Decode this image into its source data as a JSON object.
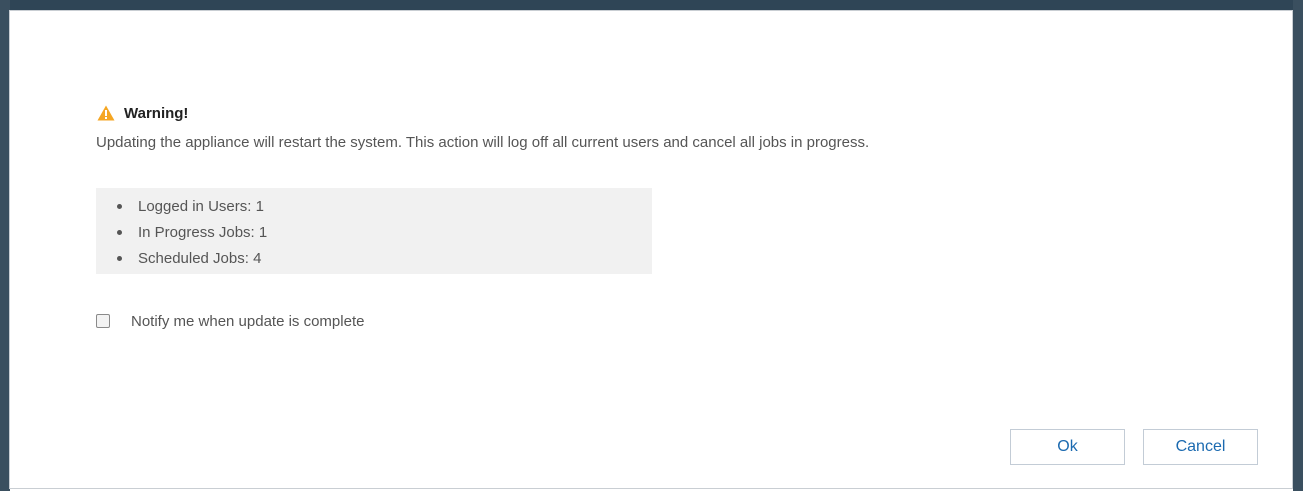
{
  "warning": {
    "icon": "warning-triangle-icon",
    "icon_color": "#f5a623",
    "title": "Warning!",
    "message": "Updating the appliance will restart the system. This action will log off all current users and cancel all jobs in progress."
  },
  "stats": [
    {
      "label": "Logged in Users: 1"
    },
    {
      "label": "In Progress Jobs: 1"
    },
    {
      "label": "Scheduled Jobs: 4"
    }
  ],
  "notify": {
    "checked": false,
    "label": "Notify me when update is complete"
  },
  "buttons": {
    "ok_label": "Ok",
    "cancel_label": "Cancel",
    "text_color": "#1b6ab0"
  }
}
